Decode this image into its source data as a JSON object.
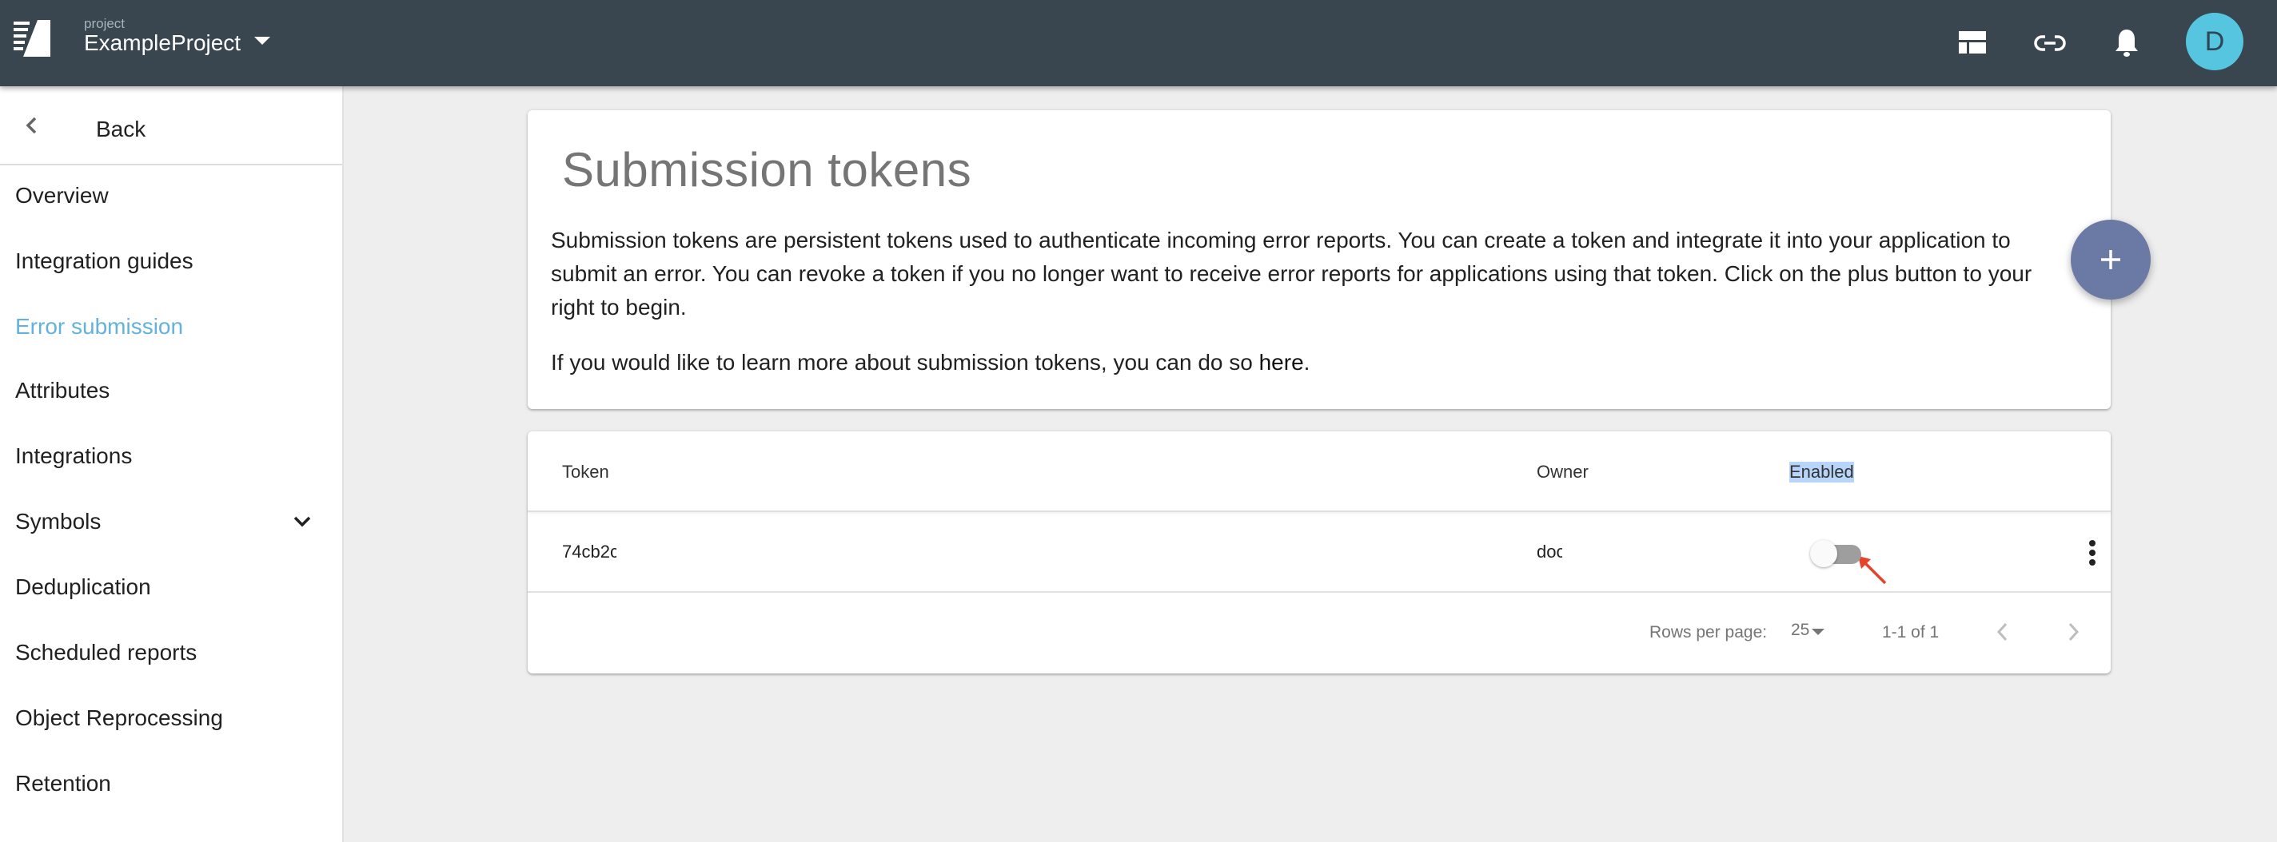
{
  "header": {
    "project_label": "project",
    "project_name": "ExampleProject",
    "icons": [
      "layout-icon",
      "link-icon",
      "bell-icon"
    ],
    "avatar_initial": "D",
    "colors": {
      "bar": "#3a464f",
      "avatar": "#56c6e0"
    }
  },
  "sidebar": {
    "back_label": "Back",
    "items": [
      {
        "label": "Overview",
        "active": false
      },
      {
        "label": "Integration guides",
        "active": false
      },
      {
        "label": "Error submission",
        "active": true
      },
      {
        "label": "Attributes",
        "active": false
      },
      {
        "label": "Integrations",
        "active": false
      },
      {
        "label": "Symbols",
        "active": false,
        "expandable": true
      },
      {
        "label": "Deduplication",
        "active": false
      },
      {
        "label": "Scheduled reports",
        "active": false
      },
      {
        "label": "Object Reprocessing",
        "active": false
      },
      {
        "label": "Retention",
        "active": false
      }
    ],
    "active_color": "#64b2dc"
  },
  "intro": {
    "title": "Submission tokens",
    "body": "Submission tokens are persistent tokens used to authenticate incoming error reports. You can create a token and integrate it into your application to submit an error. You can revoke a token if you no longer want to receive error reports for applications using that token. Click on the plus button to your right to begin.",
    "more_prefix": "If you would like to learn more about submission tokens, you can do so ",
    "more_link": "here",
    "more_suffix": "."
  },
  "fab": {
    "icon": "plus-icon",
    "color": "#6b79a5"
  },
  "table": {
    "columns": [
      "Token",
      "Owner",
      "Enabled"
    ],
    "selected_column": "Enabled",
    "rows": [
      {
        "token": "74cb2c",
        "owner": "doc",
        "enabled": false
      }
    ],
    "footer": {
      "rows_per_page_label": "Rows per page:",
      "rows_per_page_value": "25",
      "page_range": "1-1 of 1"
    }
  },
  "annotation": {
    "type": "arrow",
    "color": "#e8432a",
    "points_to": "enabled-toggle"
  }
}
